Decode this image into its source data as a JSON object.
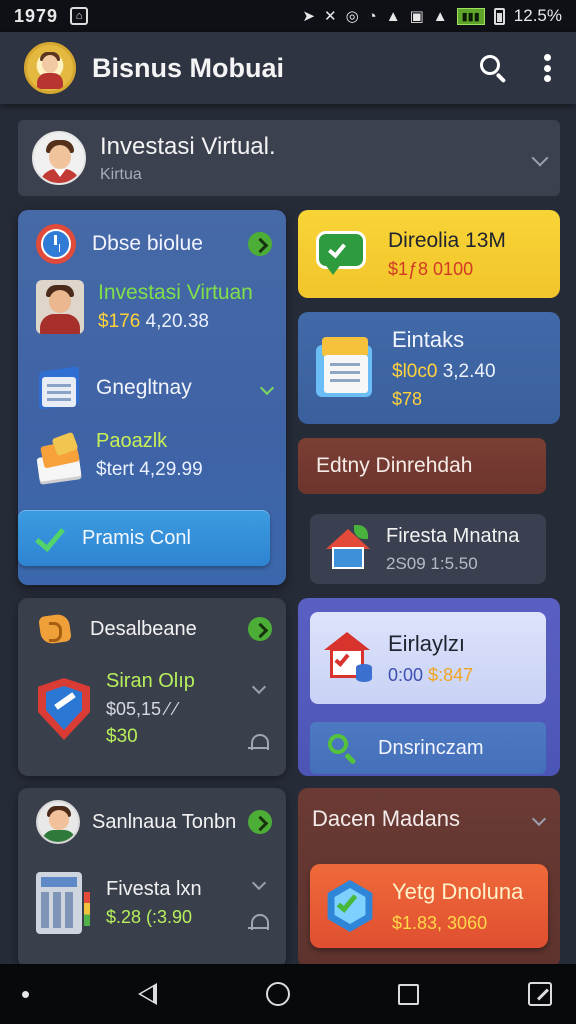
{
  "status_bar": {
    "time": "1979",
    "battery_level": "12.5%"
  },
  "app_bar": {
    "title": "Bisnus Mobuai"
  },
  "profile": {
    "title": "Investasi Virtual.",
    "subtitle": "Kirtua"
  },
  "blue_card": {
    "title": "Dbse biolue",
    "row1_title": "Investasi Virtuan",
    "row1_value_prefix": "$176",
    "row1_value_rest": " 4,20.38",
    "row2_title": "Gnegltnay",
    "row3_title": "Paoazlk",
    "row3_value": "$tert 4,29.99",
    "button_label": "Pramis Conl"
  },
  "yellow_card": {
    "title": "Direolia 13M",
    "value": "$1ƒ8 0100"
  },
  "stats_card": {
    "title": "Eintaks",
    "value_prefix": "$l0c0",
    "value_rest": " 3,2.40",
    "value2": "$78"
  },
  "red_bar": {
    "label": "Edtny Dinrehdah"
  },
  "house_card": {
    "title": "Firesta Mnatna",
    "value": "2S09 1:5.50"
  },
  "dark_card_1": {
    "title": "Desalbeane",
    "row_title": "Siran Olıp",
    "row_value": "$05,15 ⁄ ⁄",
    "row_value2": "$30"
  },
  "dark_card_2": {
    "title": "Sanlnaua Tonbn",
    "row_title": "Fivesta lxn",
    "row_value": "$.28 (:3.90"
  },
  "purple_card": {
    "title": "Eirlaylzı",
    "value_prefix": "0:00",
    "value_rest": "$:847",
    "search_label": "Dnsrinczam"
  },
  "brown_card": {
    "title": "Dacen Madans",
    "button_title": "Yetg Dnoluna",
    "button_value": "$1.83, 3060"
  },
  "colors": {
    "background": "#262b38",
    "accent_blue": "#3f63a5",
    "accent_yellow": "#f8d437",
    "accent_green": "#7fe04a",
    "accent_orange": "#ef6a3a"
  }
}
